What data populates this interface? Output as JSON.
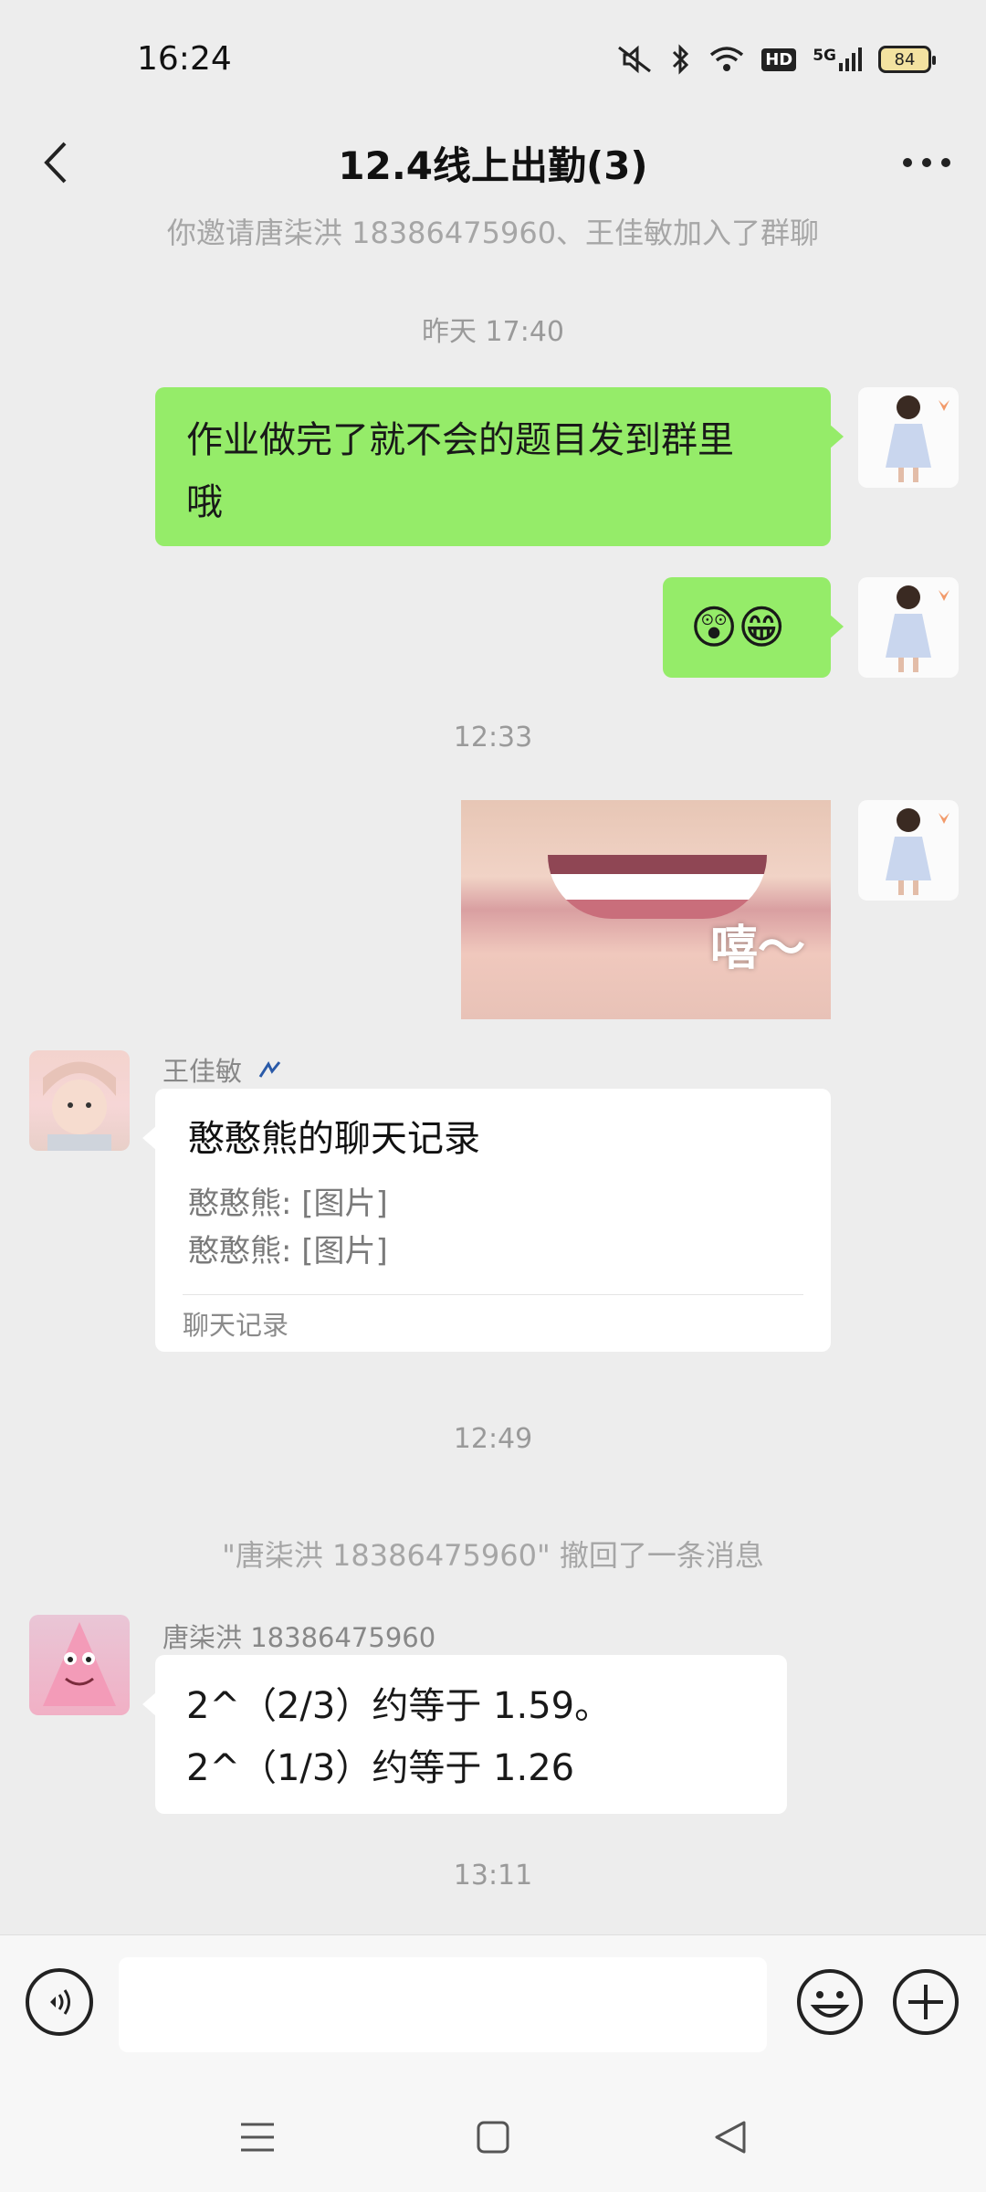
{
  "status_bar": {
    "time": "16:24",
    "battery": "84",
    "network": "5G",
    "hd": "HD"
  },
  "header": {
    "title": "12.4线上出勤(3)"
  },
  "messages": {
    "invite_notice": "你邀请唐柒洪 18386475960、王佳敏加入了群聊",
    "ts1": "昨天 17:40",
    "msg1_line1": "作业做完了就不会的题目发到群里",
    "msg1_line2": "哦",
    "msg2_emoji": "😲😁",
    "ts2": "12:33",
    "photo_caption": "嘻～",
    "sender_wang": "王佳敏",
    "record_title": "憨憨熊的聊天记录",
    "record_line1": "憨憨熊: [图片]",
    "record_line2": "憨憨熊: [图片]",
    "record_footer": "聊天记录",
    "ts3": "12:49",
    "recall_notice": "\"唐柒洪 18386475960\" 撤回了一条消息",
    "sender_tang": "唐柒洪 18386475960",
    "msg_tang_line1": "2^（2/3）约等于 1.59。",
    "msg_tang_line2": "2^（1/3）约等于 1.26",
    "ts4": "13:11"
  },
  "input": {
    "placeholder": ""
  },
  "colors": {
    "bubble_green": "#95ec69",
    "background": "#ededed"
  }
}
